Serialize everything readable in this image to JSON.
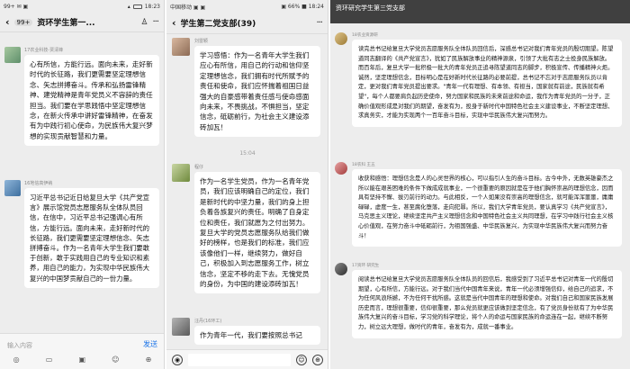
{
  "screen1": {
    "status_left": "99+ ✉ ▣",
    "status_right": "18:23",
    "back_label": "‹",
    "unread_badge": "99+",
    "title": "资环学生第一...",
    "more": "···",
    "messages": [
      {
        "sender": "17农业科技-贾清锋",
        "text": "心有所信，方能行远。面向未来，走好新时代的长征路，我们更需要坚定理想信念、矢志拼搏奋斗。传承和弘扬雷锋精神、建党精神是青年党员义不容辞的责任担当。我们要在学思践悟中坚定理想信念，在新火传承中讲好雷锋精神，在奋发有为中践行初心使命，为民族伟大复兴梦想的实现贡献智慧和力量。"
      },
      {
        "sender": "16地信高伊纳",
        "text": "习近平总书记近日给复旦大学《共产党宣言》展示馆党员志愿服务队全体队员回信，在信中，习近平总书记强调心有所信，方能行远。面向未来，走好新时代的长征路，我们更需要坚定理想信念、矢志拼搏奋斗。作为一名青年大学生我们要敢于创新，敢于实践用自己的专业知识和素养，用自己的能力，为实现中华民族伟大复兴的中国梦贡献自己的一份力量。"
      }
    ],
    "input_placeholder": "输入内容",
    "send_label": "发送",
    "tools": [
      "◎",
      "▭",
      "▣",
      "☺",
      "⊕"
    ]
  },
  "screen2": {
    "status_left": "中国移动 ▣ ▣",
    "status_right": "▣ 66% ■ 18:24",
    "back_label": "‹",
    "title": "学生第二党支部(39)",
    "more": "···",
    "messages": [
      {
        "sender": "刘雷颖",
        "text": "学习感悟：作为一名青年大学生我们应心有所信，用自己的行动和信仰坚定理想信念，我们拥有时代所赋予的责任和使命，我们应怀揣着祖国日益强大的自豪感带着责任感与使命感面向未来，不畏挑战，不惧担当，坚定信念，砥砺前行，为社会主义建设添砖加瓦！"
      },
      {
        "sender": "程仔",
        "text": "作为一名学生党员，作为一名青年党员，我们应该明确自己的定位，我们是新时代的中坚力量，我们的身上担负着各族复兴的责任。明确了自身定位和责任，我们就愿为之付出努力。复旦大学的党员志愿服务队给我们做好的榜样，也是我们的标准，我们应该像他们一样，继续努力，做好自己，积极加入到志愿服务工作，树立信念，坚定不移的走下去。无愧党员的身份，为中国的建设添砖加瓦！"
      },
      {
        "sender": "汪丹(16环工)",
        "text": "作为青年一代，我们要按照总书记"
      }
    ],
    "time_label": "15:04",
    "icons": [
      "◉",
      "☺",
      "⊕"
    ]
  },
  "screen3": {
    "title": "资环研究学生第三党支部",
    "subtitle": "",
    "messages": [
      {
        "sender": "18农业资源研",
        "text": "读完总书记给复旦大学党员志愿服务队全体队员回信后，深感总书记对我们青年党员的殷切期望。陈望道同志翻译的《共产党宣言》，犹如了民族解放事业的精神源泉，引领了大批有志之士投身民族解放。而百年后，复旦大学一批积极一批大的青年党员正追寻陈望道同志的脚步，积极宣传、传播精神火炬。诚然，坚定理想信念，目标明心是在好新时代长征路的必要前提，总书记不忘对于志愿服务队员以肯定，更对我们青年党员提出要求。\"青年一代有理想、有本领、有担当，国家就有前途，民族就有希望\"，每个人都要肩负起历史使命，努力国家和民族的未来前途和命运，我作为青年党员的一分子，正确价值观形成是对我们的期望，奋发有为，投身于新时代中国特色社会主义建设事业，不断坚定理想、求真务实，才能为实现两个一百年奋斗目标，实现中华民族伟大复兴而努力。"
      },
      {
        "sender": "18农科 王五",
        "text": "收获和感悟：理想信念是人的心灵世界的核心，可以指引人生的奋斗目标。古今中外，无数英雄豪杰之所以能在艰苦困难的条件下做成成就事业，一个很重要的原因就是在于他们胸怀崇高的理想信念，因而具有坚持不懈、拔刃前行的动力。与此相反，一个人如果没有崇高的理想信念，就可能浑浑噩噩，庸庸碌碌，虚度一生，甚至腐化堕落，走向犯罪。所以，我们大学青年党员，要认真学习《共产党宣言》，马克思主义理论，继续坚定共产主义理想信念和中国特色社会主义共同理想，在学习中践行社会主义核心价值观，在努力奋斗中砥砺前行，为祖国强盛、中华民族复兴，为实现中华民族伟大复兴而努力奋斗！"
      },
      {
        "sender": "17资环 研究生",
        "text": "阅读总书记给复旦大学党员志愿服务队全体队员的回信后，我感受到了习近平总书记对青年一代的殷切期望，心有所信，方能行远。对于我们当代中国青年来说，青年一代必须增强信仰，给自己的追求，不为任何风浪所撼，不为任何干扰所惑。这就是当代中国青年的理想和使命。对我们自己和国家民族发展历史而言，理想很重要，信仰很重要，那么党员就更应该做到坚定信念，有了党员身份就有了为中华民族伟大复兴的奋斗目标，学习党的科学理论，将个人的命运与国家民族的命运连在一起，继续不断努力，树立远大理想，做时代的青年，奋发有为，成就一番事业。"
      }
    ]
  }
}
